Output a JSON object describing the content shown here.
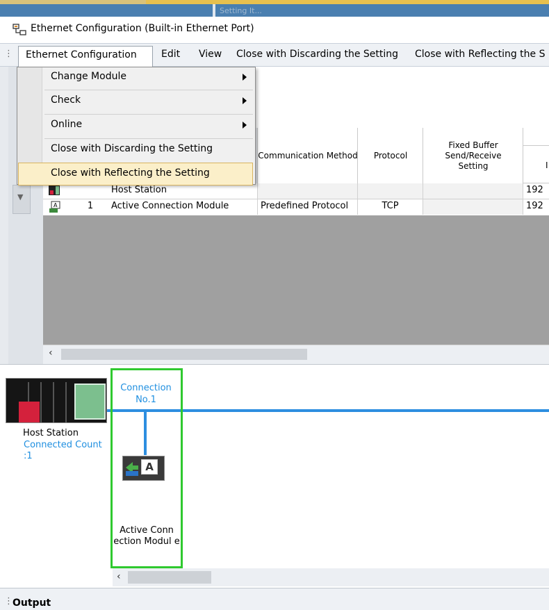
{
  "background_tab_text": "Setting It...",
  "window": {
    "title": "Ethernet Configuration (Built-in Ethernet Port)"
  },
  "menubar": {
    "items": [
      "Ethernet Configuration",
      "Edit",
      "View",
      "Close with Discarding the Setting",
      "Close with Reflecting the S"
    ]
  },
  "dropdown": {
    "items": [
      {
        "label": "Change Module",
        "submenu": true
      },
      {
        "label": "Check",
        "submenu": true
      },
      {
        "label": "Online",
        "submenu": true
      },
      {
        "label": "Close with Discarding the Setting",
        "submenu": false
      },
      {
        "label": "Close with Reflecting the Setting",
        "submenu": false,
        "highlighted": true
      }
    ]
  },
  "table": {
    "headers": [
      "Communication Method",
      "Protocol",
      "Fixed Buffer Send/Receive Setting",
      "I"
    ],
    "rows": [
      {
        "no": "",
        "model": "Host Station",
        "method": "",
        "protocol": "",
        "fixed": "",
        "ip": "192"
      },
      {
        "no": "1",
        "model": "Active Connection Module",
        "method": "Predefined Protocol",
        "protocol": "TCP",
        "fixed": "",
        "ip": "192"
      }
    ]
  },
  "diagram": {
    "connection_label": "Connection No.1",
    "host_label": "Host Station",
    "host_count": "Connected Count :1",
    "module_label": "Active Conn ection Modul e",
    "module_letter": "A",
    "colors": {
      "bus": "#2d8ee0",
      "selection": "#2fc92f",
      "text_blue": "#1f8fe0"
    }
  },
  "output": {
    "label": "Output"
  },
  "icons": {
    "scroll_left": "‹",
    "row_arrow": "▼"
  }
}
